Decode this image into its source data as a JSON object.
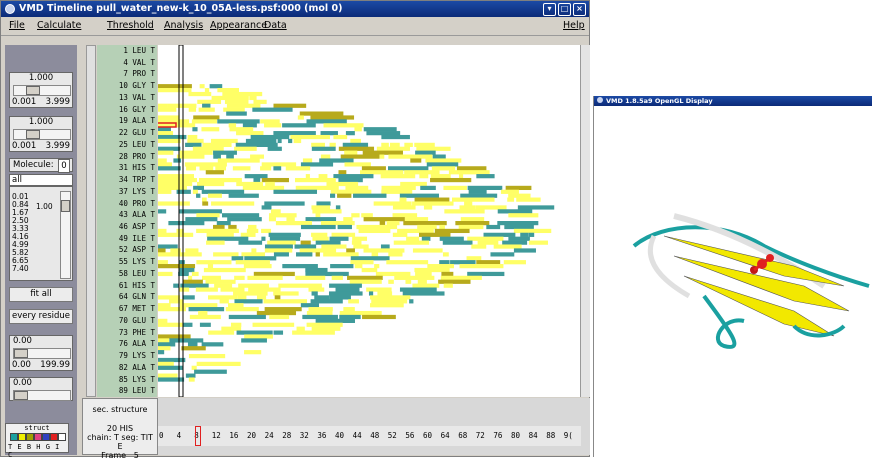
{
  "window": {
    "title": "VMD Timeline  pull_water_new-k_10_05A-less.psf:000 (mol 0)"
  },
  "menubar": {
    "items": [
      "File",
      "Calculate",
      "Threshold",
      "Analysis",
      "Appearance",
      "Data"
    ],
    "help": "Help"
  },
  "controls": {
    "slider1": {
      "value": "1.000",
      "min": "0.001",
      "max": "3.999",
      "knob": 0.25
    },
    "slider2": {
      "value": "1.000",
      "min": "0.001",
      "max": "3.999",
      "knob": 0.25
    },
    "molecule_label": "Molecule:",
    "molecule_value": "0",
    "selection": "all",
    "scale_values": [
      "0.01",
      "0.84",
      "1.67",
      "2.50",
      "3.33",
      "4.16",
      "4.99",
      "5.82",
      "6.65",
      "7.40"
    ],
    "scale_current": "1.00",
    "fit_all_label": "fit all",
    "every_residue_label": "every residue",
    "slider3": {
      "value": "0.00",
      "min": "0.00",
      "max": "199.99"
    },
    "slider4": {
      "value": "0.00"
    }
  },
  "struct_legend": {
    "title": "struct",
    "letters": "T E B H G I C",
    "colors": [
      "#1aa0a0",
      "#f0f000",
      "#a0a000",
      "#e04080",
      "#3040c0",
      "#e02020",
      "#ffffff"
    ]
  },
  "residues": [
    "1 LEU T",
    "4 VAL T",
    "7 PRO T",
    "10 GLY T",
    "13 VAL T",
    "16 GLY T",
    "19 ALA T",
    "22 GLU T",
    "25 LEU T",
    "28 PRO T",
    "31 HIS T",
    "34 TRP T",
    "37 LYS T",
    "40 PRO T",
    "43 ALA T",
    "46 ASP T",
    "49 ILE T",
    "52 ASP T",
    "55 LYS T",
    "58 LEU T",
    "61 HIS T",
    "64 GLN T",
    "67 MET T",
    "70 GLU T",
    "73 PHE T",
    "76 ALA T",
    "79 LYS T",
    "82 ALA T",
    "85 LYS T",
    "89 LEU T"
  ],
  "bottom_info": {
    "header": "sec. structure",
    "residue": "20 HIS",
    "chain_seg": "chain: T  seg: TIT",
    "struct": "E",
    "frame_label": "Frame",
    "frame_value": "5"
  },
  "frame_axis": {
    "ticks": [
      "0",
      "4",
      "8",
      "12",
      "16",
      "20",
      "24",
      "28",
      "32",
      "36",
      "40",
      "44",
      "48",
      "52",
      "56",
      "60",
      "64",
      "68",
      "72",
      "76",
      "80",
      "84",
      "88",
      "9("
    ],
    "selected_frame": 4
  },
  "gl_window": {
    "title": "VMD 1.8.5a9 OpenGL Display"
  },
  "colors": {
    "teal": "#3f9a9a",
    "yellow": "#ffff66",
    "olive": "#b7aa1c",
    "highlight": "#e02020"
  }
}
